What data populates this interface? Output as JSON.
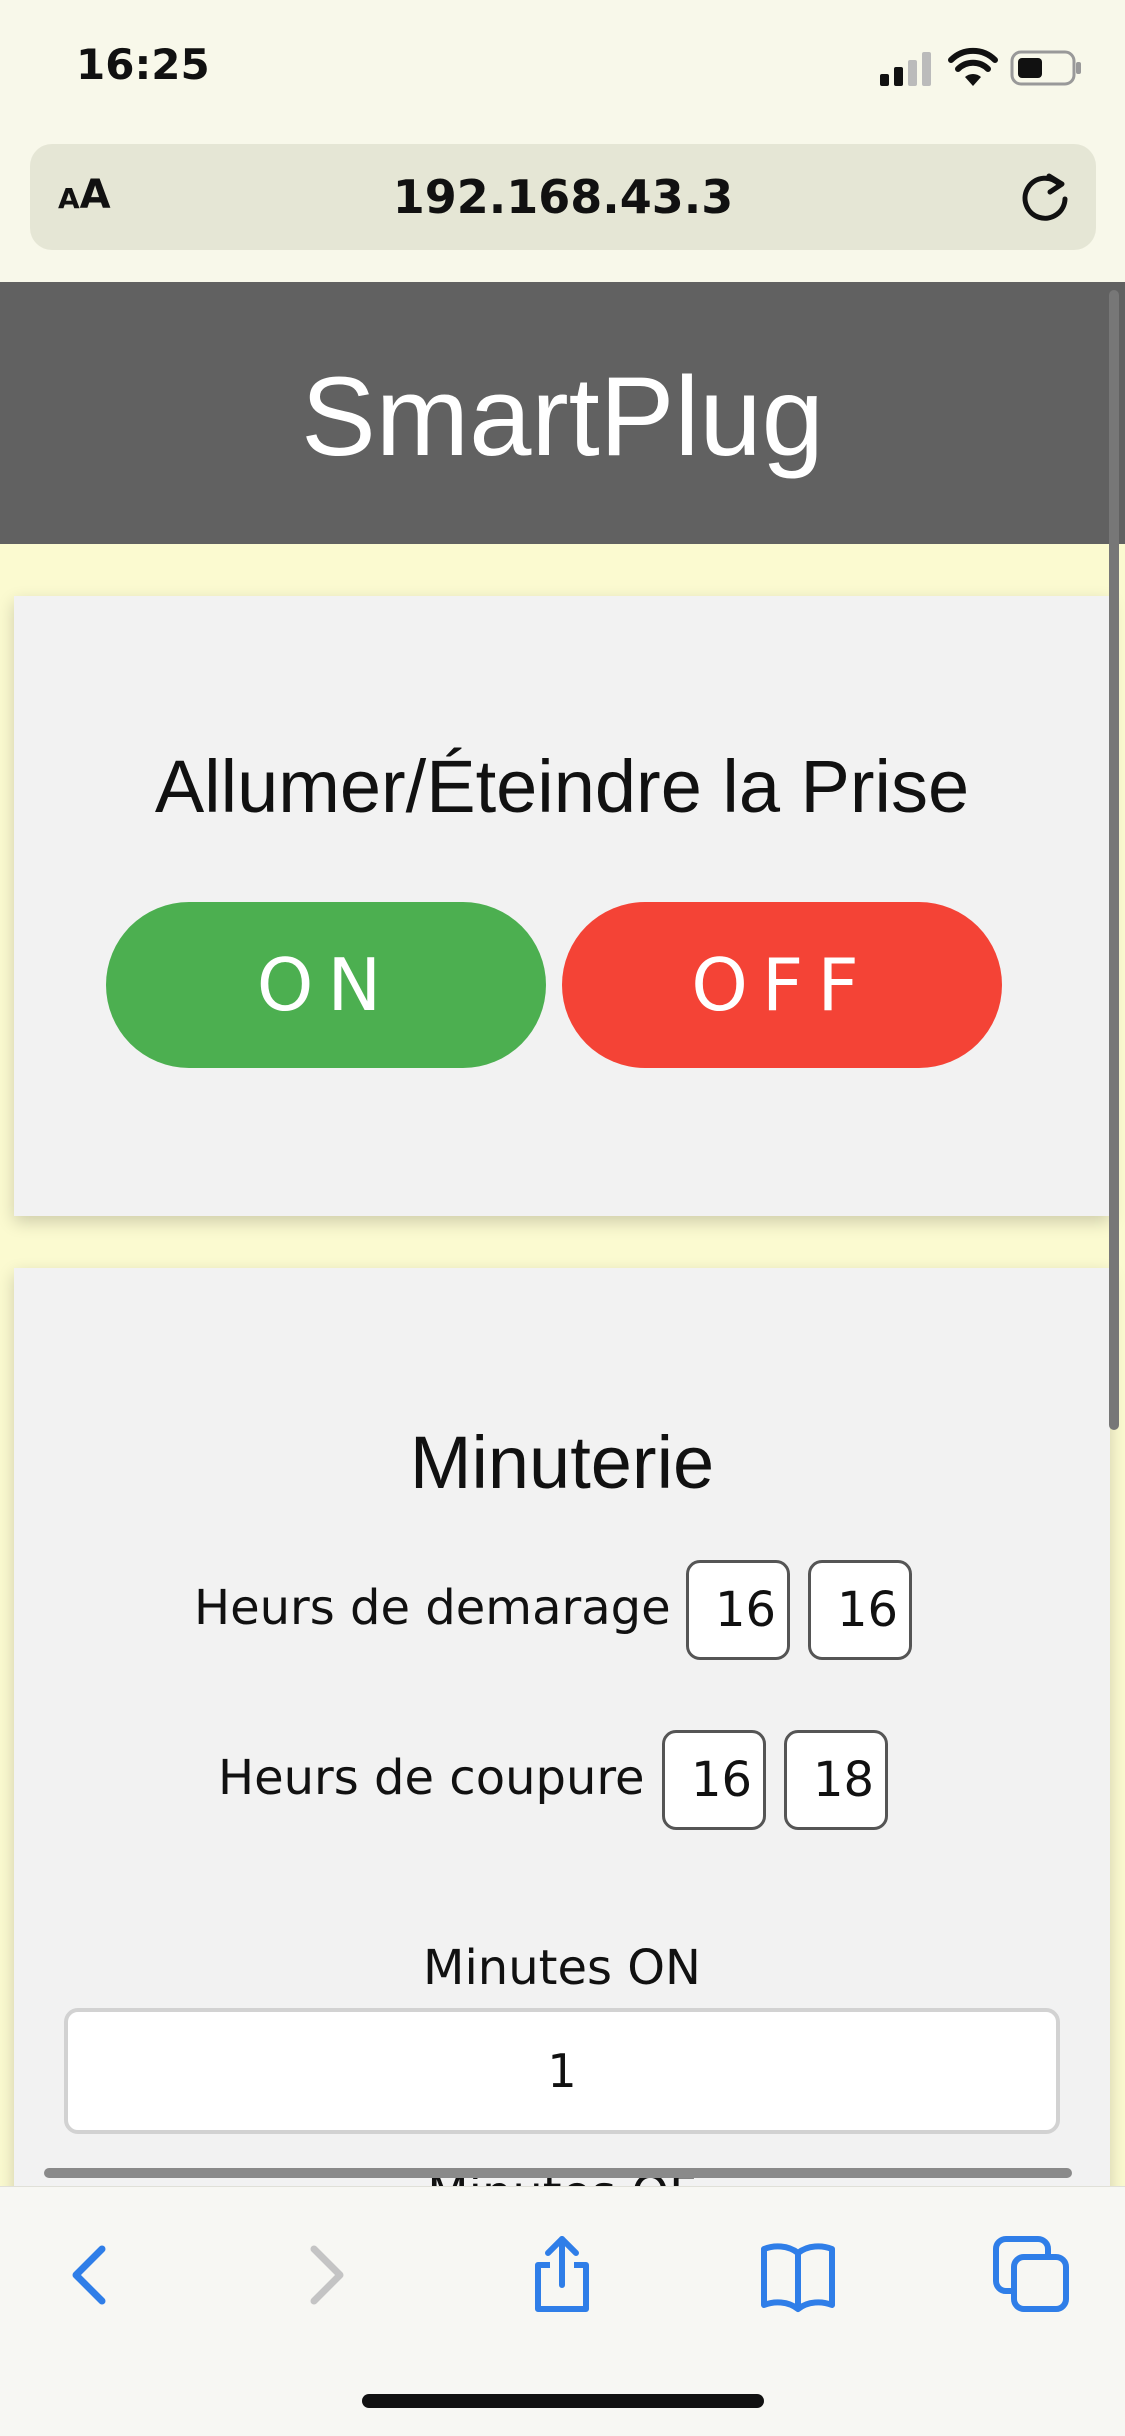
{
  "status_bar": {
    "time": "16:25"
  },
  "browser": {
    "text_size_label": "AA",
    "url": "192.168.43.3"
  },
  "header": {
    "title": "SmartPlug"
  },
  "power_card": {
    "title": "Allumer/Éteindre la Prise",
    "on_label": "ON",
    "off_label": "OFF"
  },
  "timer_card": {
    "title": "Minuterie",
    "start_label": "Heurs de demarage",
    "start_hour": "16",
    "start_minute": "16",
    "stop_label": "Heurs de coupure",
    "stop_hour": "16",
    "stop_minute": "18",
    "minutes_on_label": "Minutes ON",
    "minutes_on_value": "1",
    "minutes_off_label": "Minutes OF"
  },
  "colors": {
    "on": "#4caf50",
    "off": "#f44336",
    "header": "#616161",
    "accent": "#2f7ee8"
  }
}
